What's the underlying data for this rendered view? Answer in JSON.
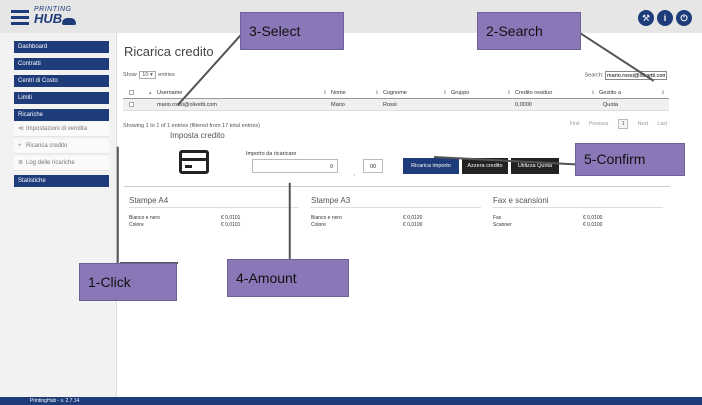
{
  "header": {
    "logo_top": "PRINTING",
    "logo_bottom": "HUB",
    "icons": [
      "wrench-icon",
      "info-icon",
      "power-icon"
    ]
  },
  "sidebar": {
    "items": [
      {
        "label": "Dashboard",
        "style": "blue"
      },
      {
        "label": "Contratti",
        "style": "blue"
      },
      {
        "label": "Centri di Costo",
        "style": "blue"
      },
      {
        "label": "Limiti",
        "style": "blue"
      },
      {
        "label": "Ricariche",
        "style": "blue"
      },
      {
        "label": "Impostazioni di vendita",
        "style": "sub",
        "icon": "≪"
      },
      {
        "label": "Ricarica credito",
        "style": "sub",
        "icon": "+"
      },
      {
        "label": "Log delle ricariche",
        "style": "sub",
        "icon": "≣"
      },
      {
        "label": "Statistiche",
        "style": "blue"
      }
    ]
  },
  "main": {
    "title": "Ricarica credito",
    "show_label": "Show",
    "show_value": "10",
    "entries_label": "entries",
    "search_label": "Search:",
    "search_value": "mario.rossi@olivetti.com",
    "table": {
      "headers": [
        "Username",
        "Nome",
        "Cognome",
        "Gruppo",
        "Credito residuo",
        "Gestito a"
      ],
      "rows": [
        {
          "username": "mario.rossi@olivetti.com",
          "nome": "Mario",
          "cognome": "Rossi",
          "gruppo": "",
          "credito": "0,0000",
          "gestito": "Quota"
        }
      ]
    },
    "info": "Showing 1 to 1 of 1 entries (filtered from 17 total entries)",
    "pager": {
      "first": "First",
      "previous": "Previous",
      "current": "1",
      "next": "Next",
      "last": "Last"
    },
    "credit": {
      "title": "Imposta credito",
      "amount_label": "Importo da ricaricare",
      "amount_int": "0",
      "amount_sep": ",",
      "amount_dec": "00",
      "btn_recharge": "Ricarica importo",
      "btn_reset": "Azzera credito",
      "btn_quota": "Utilizza Quota"
    },
    "prices": [
      {
        "title": "Stampe A4",
        "rows": [
          {
            "k": "Bianco e nero",
            "v": "€ 0,0101"
          },
          {
            "k": "Colore",
            "v": "€ 0,0101"
          }
        ]
      },
      {
        "title": "Stampe A3",
        "rows": [
          {
            "k": "Bianco e nero",
            "v": "€ 0,0120"
          },
          {
            "k": "Colore",
            "v": "€ 0,0100"
          }
        ]
      },
      {
        "title": "Fax e scansioni",
        "rows": [
          {
            "k": "Fax",
            "v": "€ 0,0100"
          },
          {
            "k": "Scanner",
            "v": "€ 0,0100"
          }
        ]
      }
    ]
  },
  "footer": {
    "version": "PrintingHub - v. 2.7.14"
  },
  "annotations": {
    "click": "1-Click",
    "search": "2-Search",
    "select": "3-Select",
    "amount": "4-Amount",
    "confirm": "5-Confirm"
  },
  "colors": {
    "brand": "#1e3c7a",
    "callout": "#8a77b7"
  }
}
